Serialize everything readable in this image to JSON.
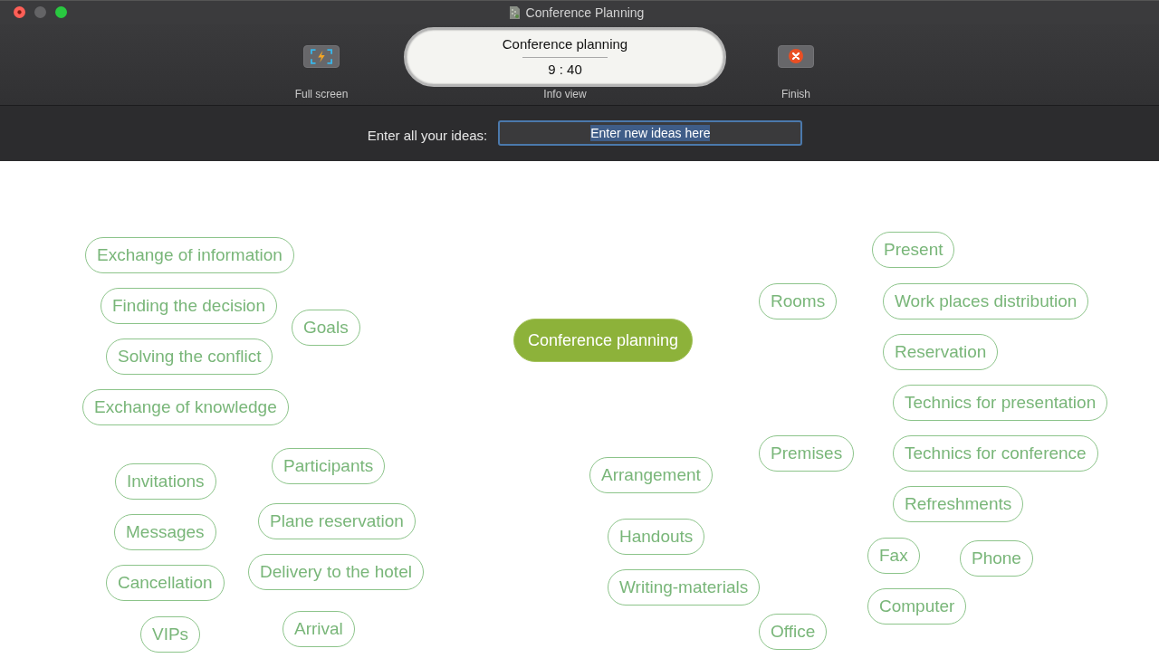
{
  "window": {
    "title": "Conference Planning"
  },
  "toolbar": {
    "full_screen_button": {
      "label": "Full screen"
    },
    "info_view": {
      "title": "Conference planning",
      "time": "9 : 40",
      "label": "Info view"
    },
    "finish_button": {
      "label": "Finish"
    }
  },
  "idea_entry": {
    "label": "Enter all your ideas:",
    "value": "Enter new ideas here",
    "text_selected": true
  },
  "mind_map": {
    "central_topic": "Conference planning",
    "idea_groups": [
      {
        "ideas": [
          "Exchange of information",
          "Finding the decision",
          "Solving the conflict",
          "Goals",
          "Exchange of knowledge"
        ]
      },
      {
        "ideas": [
          "Invitations",
          "Participants",
          "Messages",
          "Plane reservation",
          "Cancellation",
          "Delivery to the hotel",
          "VIPs",
          "Arrival"
        ]
      },
      {
        "ideas": [
          "Arrangement",
          "Handouts",
          "Writing-materials"
        ]
      },
      {
        "ideas": [
          "Present",
          "Rooms",
          "Work places distribution",
          "Reservation",
          "Technics for presentation",
          "Premises",
          "Technics for conference",
          "Refreshments",
          "Fax",
          "Phone",
          "Office",
          "Computer"
        ]
      }
    ]
  }
}
